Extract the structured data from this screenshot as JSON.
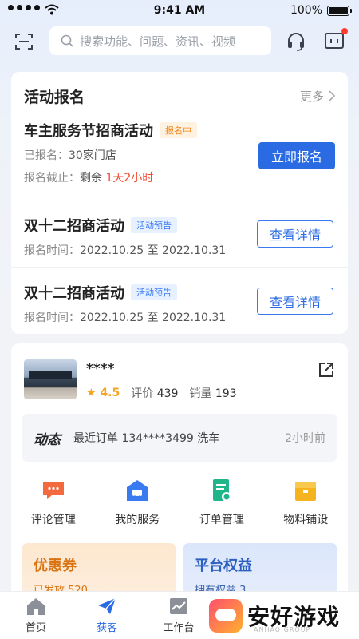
{
  "status_bar": {
    "time": "9:41 AM",
    "battery": "100%"
  },
  "search": {
    "placeholder": "搜索功能、问题、资讯、视频"
  },
  "activity": {
    "title": "活动报名",
    "more": "更多",
    "featured": {
      "title": "车主服务节招商活动",
      "tag": "报名中",
      "registered_label": "已报名：",
      "registered_value": "30家门店",
      "deadline_label": "报名截止：",
      "deadline_prefix": "剩余",
      "deadline_value": "1天2小时",
      "button": "立即报名"
    },
    "items": [
      {
        "title": "双十二招商活动",
        "tag": "活动预告",
        "time_label": "报名时间：",
        "time_value": "2022.10.25 至 2022.10.31",
        "button": "查看详情"
      },
      {
        "title": "双十二招商活动",
        "tag": "活动预告",
        "time_label": "报名时间：",
        "time_value": "2022.10.25 至 2022.10.31",
        "button": "查看详情"
      }
    ]
  },
  "store": {
    "name": "****",
    "rating": "4.5",
    "reviews_label": "评价",
    "reviews": "439",
    "sales_label": "销量",
    "sales": "193",
    "feed_label": "动态",
    "feed_text": "最近订单 134****3499 洗车",
    "feed_time": "2小时前"
  },
  "quick_actions": [
    {
      "label": "评论管理",
      "icon": "comment-icon",
      "color": "#f26a3d"
    },
    {
      "label": "我的服务",
      "icon": "car-service-icon",
      "color": "#3a7af0"
    },
    {
      "label": "订单管理",
      "icon": "order-icon",
      "color": "#21b58c"
    },
    {
      "label": "物料铺设",
      "icon": "material-icon",
      "color": "#f5b41f"
    }
  ],
  "promos": {
    "coupon": {
      "title": "优惠券",
      "sub": "已发放 520"
    },
    "rights": {
      "title": "平台权益",
      "sub": "拥有权益 3"
    }
  },
  "tabs": [
    {
      "label": "首页"
    },
    {
      "label": "获客"
    },
    {
      "label": "工作台"
    }
  ],
  "watermark": {
    "text": "安好游戏",
    "sub": "ANHAO GROUP"
  },
  "colors": {
    "primary": "#2a6be3",
    "accent_red": "#f04a2f",
    "notification": "#ff3b30"
  }
}
